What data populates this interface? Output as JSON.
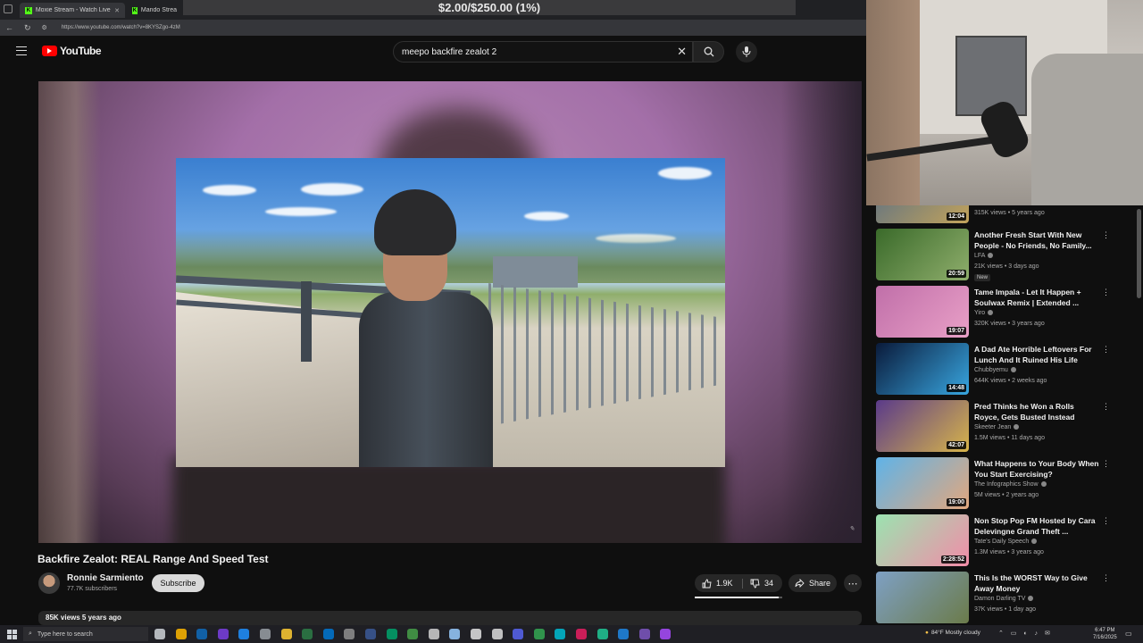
{
  "browser": {
    "tabs": [
      {
        "label": "Moxie Stream - Watch Live on Ki",
        "active": true
      },
      {
        "label": "Mando Stream - I",
        "active": false
      }
    ],
    "url": "https://www.youtube.com/watch?v=8KYSZgo-4zM"
  },
  "overlay": {
    "donation_goal": "$2.00/$250.00 (1%)"
  },
  "youtube": {
    "logo_text": "YouTube",
    "search_value": "meepo backfire zealot 2",
    "video": {
      "title": "Backfire Zealot: REAL Range And Speed Test",
      "channel": "Ronnie Sarmiento",
      "subscribers": "77.7K subscribers",
      "subscribe_label": "Subscribe",
      "likes": "1.9K",
      "dislikes": "34",
      "share_label": "Share",
      "views_date": "85K views  5 years ago"
    },
    "recommendations": {
      "top_partial_meta": "315K views • 5 years ago",
      "top_partial_duration": "12:04",
      "items": [
        {
          "title": "Another Fresh Start With New People - No Friends, No Family...",
          "channel": "LFA",
          "meta": "21K views • 3 days ago",
          "duration": "20:59",
          "badge": "New",
          "colors": [
            "#3a6a2a",
            "#8fae6c"
          ]
        },
        {
          "title": "Tame Impala - Let It Happen + Soulwax Remix | Extended ...",
          "channel": "Yiro",
          "meta": "320K views • 3 years ago",
          "duration": "19:07",
          "colors": [
            "#c06fa9",
            "#e9a0c7"
          ]
        },
        {
          "title": "A Dad Ate Horrible Leftovers For Lunch And It Ruined His Life",
          "channel": "Chubbyemu",
          "meta": "644K views • 2 weeks ago",
          "duration": "14:48",
          "colors": [
            "#0a1a3a",
            "#38a6e0"
          ]
        },
        {
          "title": "Pred Thinks he Won a Rolls Royce, Gets Busted Instead",
          "channel": "Skeeter Jean",
          "meta": "1.5M views • 11 days ago",
          "duration": "42:07",
          "colors": [
            "#5a3a8a",
            "#d7b44a"
          ]
        },
        {
          "title": "What Happens to Your Body When You Start Exercising?",
          "channel": "The Infographics Show",
          "meta": "5M views • 2 years ago",
          "duration": "19:00",
          "colors": [
            "#5fb3e8",
            "#e2a77d"
          ]
        },
        {
          "title": "Non Stop Pop FM Hosted by Cara Delevingne Grand Theft ...",
          "channel": "Tate's Daily Speech",
          "meta": "1.3M views • 3 years ago",
          "duration": "2:28:52",
          "colors": [
            "#9be3b0",
            "#f28ca8"
          ]
        },
        {
          "title": "This Is the WORST Way to Give Away Money",
          "channel": "Damon Darling TV",
          "meta": "37K views • 1 day ago",
          "duration": "",
          "colors": [
            "#7ea0c4",
            "#6b7b4a"
          ]
        }
      ]
    }
  },
  "taskbar": {
    "search_placeholder": "Type here to search",
    "weather": "84°F  Mostly cloudy",
    "time": "6:47 PM",
    "date": "7/16/2025"
  }
}
